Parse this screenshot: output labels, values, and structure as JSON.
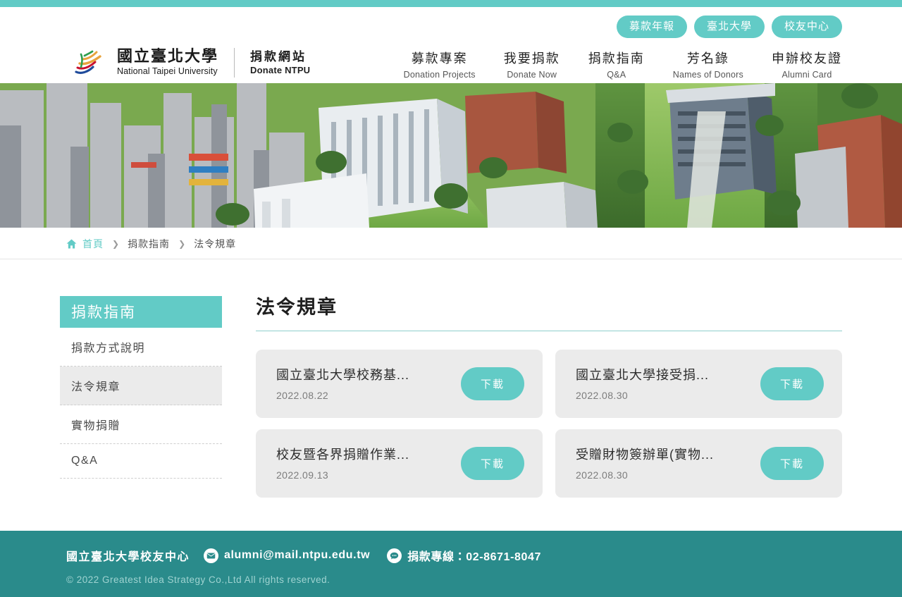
{
  "theme": {
    "accent_teal": "#62cbc6",
    "footer_teal": "#2a8b8b",
    "card_gray": "#ebebeb"
  },
  "header": {
    "pills": [
      {
        "label": "募款年報",
        "name": "annual-report"
      },
      {
        "label": "臺北大學",
        "name": "ntpu-main-site"
      },
      {
        "label": "校友中心",
        "name": "alumni-center"
      }
    ],
    "logo": {
      "cn": "國立臺北大學",
      "en": "National Taipei University"
    },
    "site_name": {
      "cn": "捐款網站",
      "en": "Donate NTPU"
    },
    "nav": [
      {
        "cn": "募款專案",
        "en": "Donation Projects",
        "name": "donation-projects"
      },
      {
        "cn": "我要捐款",
        "en": "Donate Now",
        "name": "donate-now"
      },
      {
        "cn": "捐款指南",
        "en": "Q&A",
        "name": "donation-guide"
      },
      {
        "cn": "芳名錄",
        "en": "Names of Donors",
        "name": "names-of-donors"
      },
      {
        "cn": "申辦校友證",
        "en": "Alumni Card",
        "name": "alumni-card"
      }
    ]
  },
  "breadcrumb": {
    "home": "首頁",
    "separator": "❯",
    "trail": [
      {
        "label": "捐款指南"
      },
      {
        "label": "法令規章"
      }
    ]
  },
  "sidebar": {
    "heading": "捐款指南",
    "items": [
      {
        "label": "捐款方式說明",
        "active": false
      },
      {
        "label": "法令規章",
        "active": true
      },
      {
        "label": "實物捐贈",
        "active": false
      },
      {
        "label": "Q&A",
        "active": false
      }
    ]
  },
  "main": {
    "title": "法令規章",
    "download_label": "下載",
    "documents": [
      {
        "title": "國立臺北大學校務基...",
        "date": "2022.08.22"
      },
      {
        "title": "國立臺北大學接受捐...",
        "date": "2022.08.30"
      },
      {
        "title": "校友暨各界捐贈作業...",
        "date": "2022.09.13"
      },
      {
        "title": "受贈財物簽辦單(實物...",
        "date": "2022.08.30"
      }
    ]
  },
  "footer": {
    "org": "國立臺北大學校友中心",
    "email": "alumni@mail.ntpu.edu.tw",
    "hotline": "捐款專線：02-8671-8047",
    "copyright": "© 2022 Greatest Idea Strategy Co.,Ltd All rights reserved."
  }
}
